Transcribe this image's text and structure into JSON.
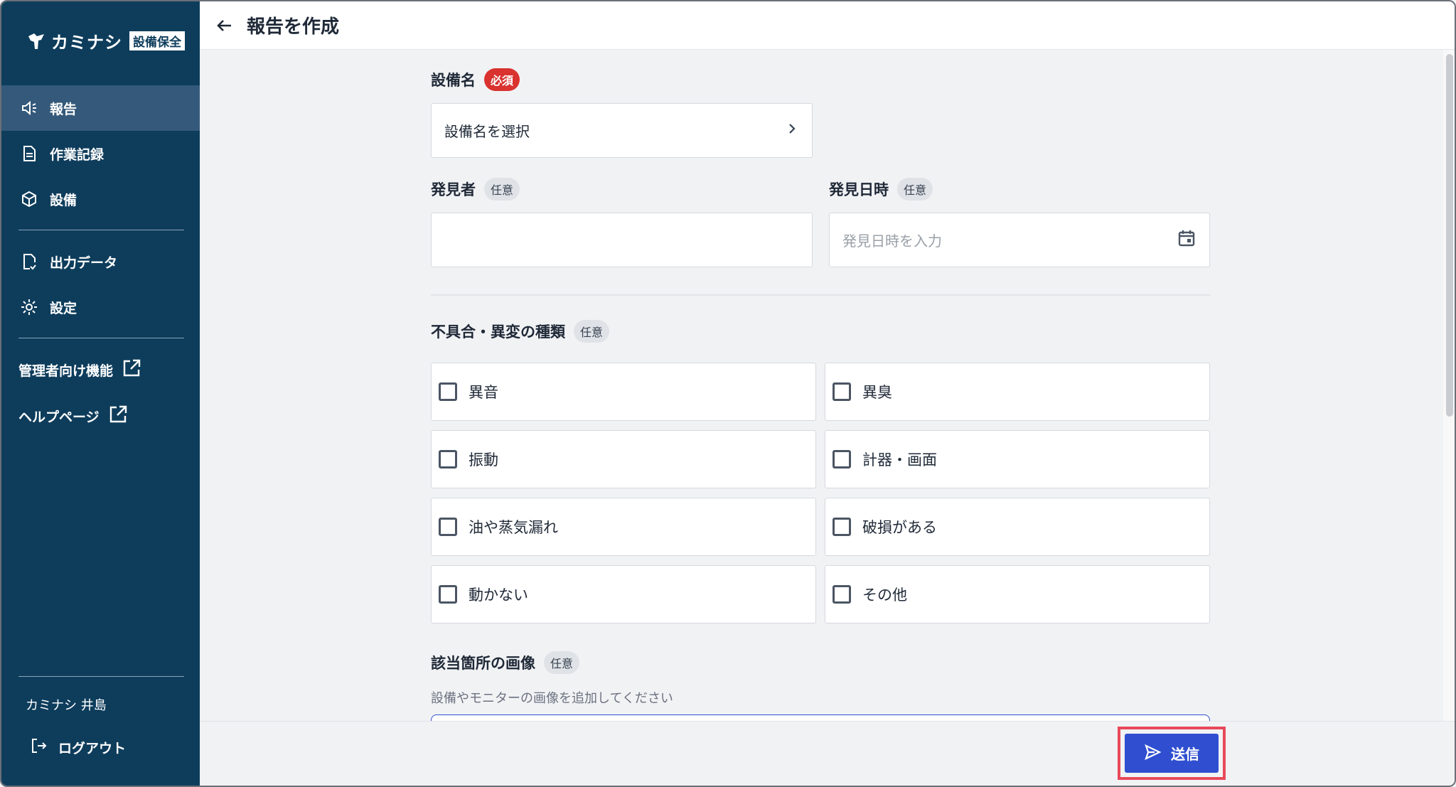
{
  "sidebar": {
    "logo_text": "カミナシ",
    "logo_badge": "設備保全",
    "nav": [
      {
        "label": "報告",
        "icon": "megaphone-icon",
        "active": true
      },
      {
        "label": "作業記録",
        "icon": "document-icon",
        "active": false
      },
      {
        "label": "設備",
        "icon": "cube-icon",
        "active": false
      },
      {
        "label": "出力データ",
        "icon": "file-export-icon",
        "active": false
      },
      {
        "label": "設定",
        "icon": "gear-icon",
        "active": false
      }
    ],
    "external": [
      {
        "label": "管理者向け機能",
        "icon": "external-link-icon"
      },
      {
        "label": "ヘルプページ",
        "icon": "external-link-icon"
      }
    ],
    "user_name": "カミナシ 井島",
    "logout_label": "ログアウト"
  },
  "header": {
    "title": "報告を作成"
  },
  "form": {
    "equipment": {
      "label": "設備名",
      "badge": "必須",
      "placeholder": "設備名を選択"
    },
    "finder": {
      "label": "発見者",
      "badge": "任意",
      "value": ""
    },
    "found_at": {
      "label": "発見日時",
      "badge": "任意",
      "placeholder": "発見日時を入力"
    },
    "defect_types": {
      "label": "不具合・異変の種類",
      "badge": "任意",
      "options": [
        {
          "label": "異音",
          "checked": false
        },
        {
          "label": "異臭",
          "checked": false
        },
        {
          "label": "振動",
          "checked": false
        },
        {
          "label": "計器・画面",
          "checked": false
        },
        {
          "label": "油や蒸気漏れ",
          "checked": false
        },
        {
          "label": "破損がある",
          "checked": false
        },
        {
          "label": "動かない",
          "checked": false
        },
        {
          "label": "その他",
          "checked": false
        }
      ]
    },
    "images": {
      "label": "該当箇所の画像",
      "badge": "任意",
      "helper": "設備やモニターの画像を追加してください"
    }
  },
  "footer": {
    "submit_label": "送信"
  },
  "colors": {
    "sidebar_bg": "#0e3d5c",
    "active_item": "#34597a",
    "primary": "#2f4fd0",
    "required": "#d9322f",
    "highlight": "#e8495a"
  }
}
